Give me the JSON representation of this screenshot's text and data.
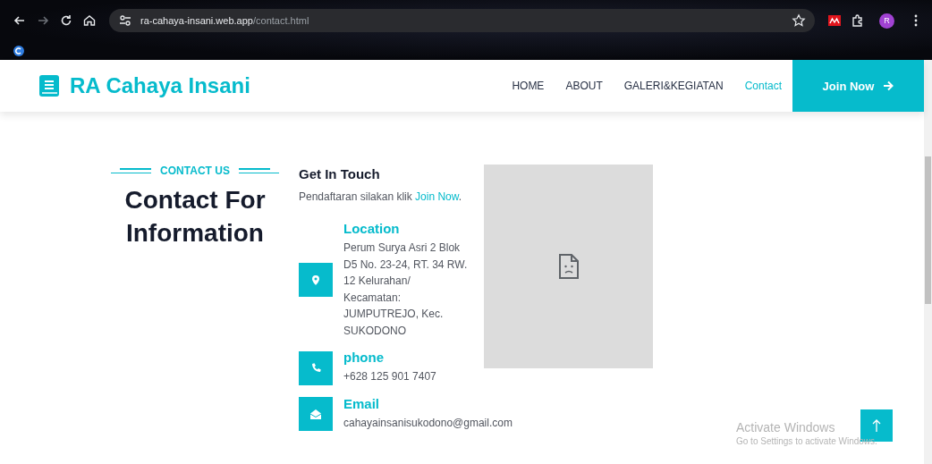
{
  "browser": {
    "url_host": "ra-cahaya-insani.web.app",
    "url_path": "/contact.html",
    "profile_initial": "R",
    "forward_disabled": true
  },
  "navbar": {
    "brand": "RA Cahaya Insani",
    "links": [
      {
        "label": "HOME",
        "selected": false
      },
      {
        "label": "ABOUT",
        "selected": false
      },
      {
        "label": "GALERI&KEGIATAN",
        "selected": false
      },
      {
        "label": "Contact",
        "selected": true
      }
    ],
    "cta": "Join Now"
  },
  "section": {
    "eyebrow": "CONTACT US",
    "title_lines": [
      "Contact For",
      "Information"
    ]
  },
  "get_in_touch": {
    "heading": "Get In Touch",
    "text": "Pendaftaran silakan klik",
    "link": "Join Now",
    "after_link": "."
  },
  "contacts": [
    {
      "kind": "location",
      "title": "Location",
      "text": "Perum Surya Asri 2 Blok D5 No. 23-24, RT. 34 RW. 12 Kelurahan/ Kecamatan: JUMPUTREJO, Kec. SUKODONO"
    },
    {
      "kind": "phone",
      "title": "phone",
      "text": "+628 125 901 7407"
    },
    {
      "kind": "email",
      "title": "Email",
      "text": "cahayainsanisukodono@gmail.com"
    }
  ],
  "map": {
    "kind": "broken"
  },
  "os_watermark": {
    "title": "Activate Windows",
    "text": "Go to Settings to activate Windows."
  }
}
